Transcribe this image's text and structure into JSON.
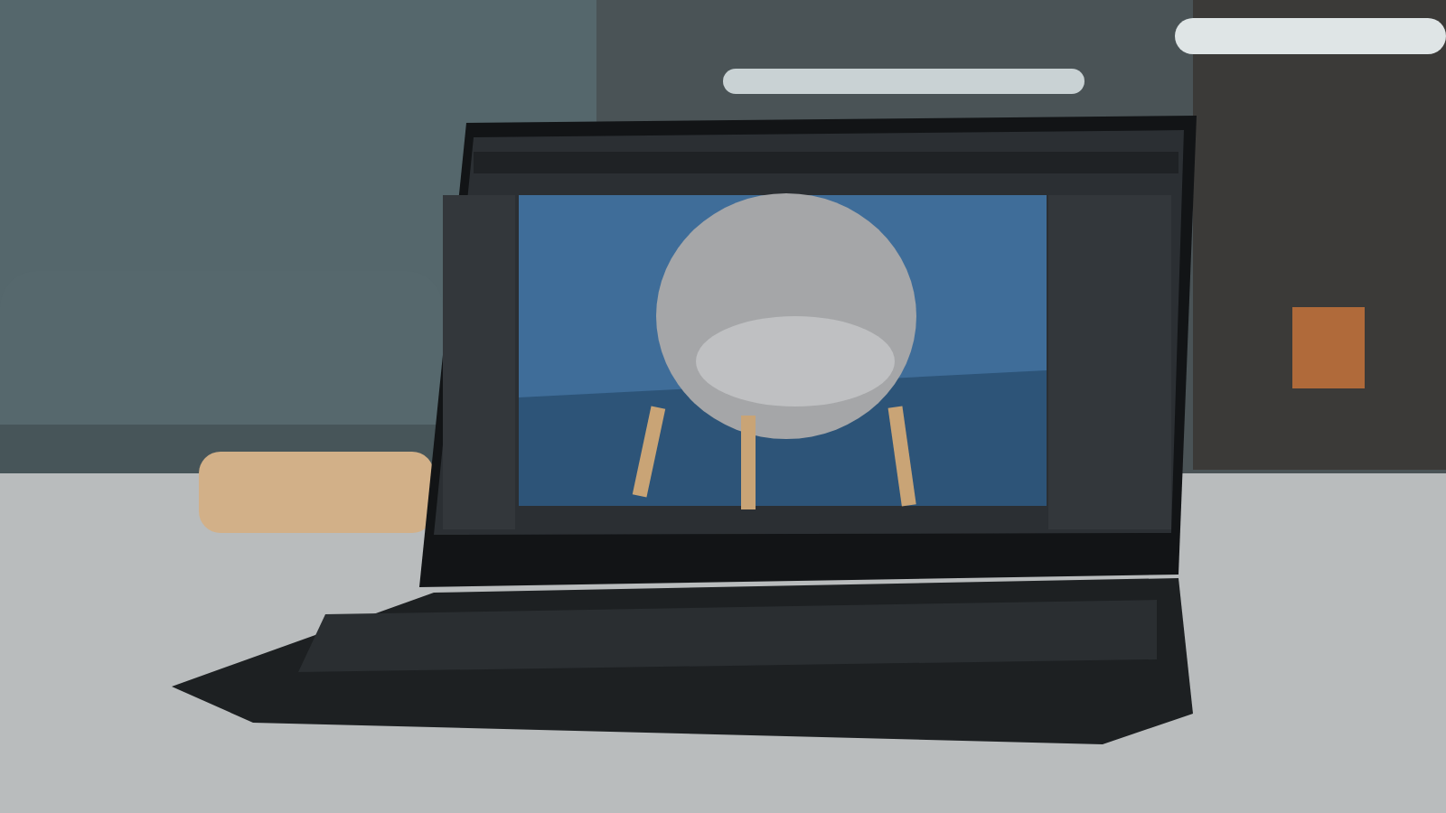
{
  "photo": {
    "kind": "laptop-scene"
  }
}
